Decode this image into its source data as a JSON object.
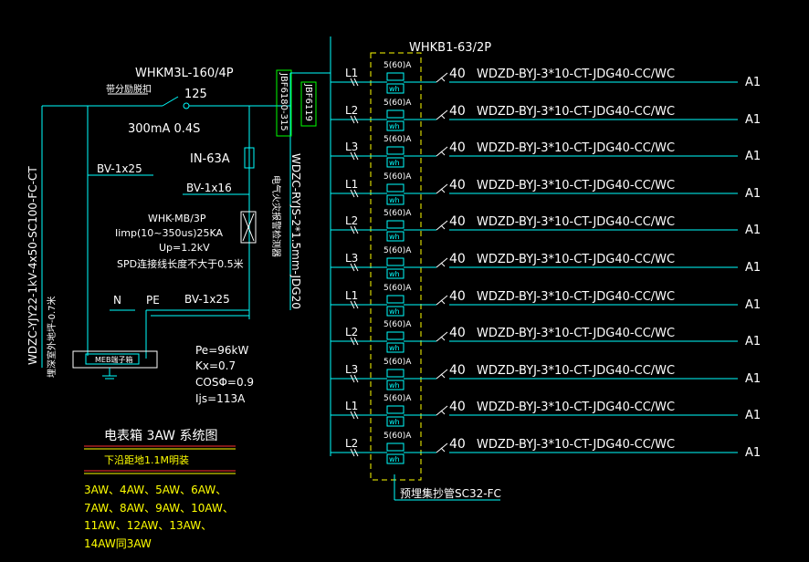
{
  "colors": {
    "background": "#000000",
    "wire": "#00ffff",
    "text": "#ffffff",
    "meter": "#00ffff",
    "dash_box": "#ffff00",
    "green_box": "#00ff00",
    "underline_red": "#ff3030"
  },
  "incoming": {
    "cable": "WDZC-YJY22-1kV-4x50-SC100-FC-CT",
    "note": "埋深室外地坪-0.7米"
  },
  "main_breaker": {
    "model": "WHKM3L-160/4P",
    "note": "带分励脱扣",
    "rating": "125",
    "leakage": "300mA 0.4S"
  },
  "fuse": {
    "label": "IN-63A"
  },
  "spd": {
    "model": "WHK-MB/3P",
    "imp": "Iimp(10~350us)25KA",
    "up": "Up=1.2kV",
    "note": "SPD连接线长度不大于0.5米"
  },
  "ground_wires": {
    "bv1": "BV-1x25",
    "bv2": "BV-1x16",
    "bv3": "BV-1x25",
    "n": "N",
    "pe": "PE",
    "meb": "MEB端子箱"
  },
  "fire_monitor": {
    "jbf1": "JBF6180-315",
    "jbf2": "JBF6119",
    "note": "电气火灾报警检测器",
    "cable": "WDZC-RYJS-2*1.5mm-JDG20"
  },
  "params": {
    "pe": "Pe=96kW",
    "kx": "Kx=0.7",
    "cos": "COSΦ=0.9",
    "ijs": "Ijs=113A"
  },
  "title_block": {
    "title": "电表箱 3AW 系统图",
    "mount": "下沿距地1.1M明装",
    "applies": [
      "3AW、4AW、5AW、6AW、",
      "7AW、8AW、9AW、10AW、",
      "11AW、12AW、13AW、",
      "14AW同3AW"
    ]
  },
  "branch_breaker": "WHKB1-63/2P",
  "spare_pipe": "预埋集抄管SC32-FC",
  "branches": [
    {
      "phase": "L1",
      "meter": "5(60)A",
      "wh": "wh",
      "rating": "40",
      "cable": "WDZD-BYJ-3*10-CT-JDG40-CC/WC",
      "dest": "A1"
    },
    {
      "phase": "L2",
      "meter": "5(60)A",
      "wh": "wh",
      "rating": "40",
      "cable": "WDZD-BYJ-3*10-CT-JDG40-CC/WC",
      "dest": "A1"
    },
    {
      "phase": "L3",
      "meter": "5(60)A",
      "wh": "wh",
      "rating": "40",
      "cable": "WDZD-BYJ-3*10-CT-JDG40-CC/WC",
      "dest": "A1"
    },
    {
      "phase": "L1",
      "meter": "5(60)A",
      "wh": "wh",
      "rating": "40",
      "cable": "WDZD-BYJ-3*10-CT-JDG40-CC/WC",
      "dest": "A1"
    },
    {
      "phase": "L2",
      "meter": "5(60)A",
      "wh": "wh",
      "rating": "40",
      "cable": "WDZD-BYJ-3*10-CT-JDG40-CC/WC",
      "dest": "A1"
    },
    {
      "phase": "L3",
      "meter": "5(60)A",
      "wh": "wh",
      "rating": "40",
      "cable": "WDZD-BYJ-3*10-CT-JDG40-CC/WC",
      "dest": "A1"
    },
    {
      "phase": "L1",
      "meter": "5(60)A",
      "wh": "wh",
      "rating": "40",
      "cable": "WDZD-BYJ-3*10-CT-JDG40-CC/WC",
      "dest": "A1"
    },
    {
      "phase": "L2",
      "meter": "5(60)A",
      "wh": "wh",
      "rating": "40",
      "cable": "WDZD-BYJ-3*10-CT-JDG40-CC/WC",
      "dest": "A1"
    },
    {
      "phase": "L3",
      "meter": "5(60)A",
      "wh": "wh",
      "rating": "40",
      "cable": "WDZD-BYJ-3*10-CT-JDG40-CC/WC",
      "dest": "A1"
    },
    {
      "phase": "L1",
      "meter": "5(60)A",
      "wh": "wh",
      "rating": "40",
      "cable": "WDZD-BYJ-3*10-CT-JDG40-CC/WC",
      "dest": "A1"
    },
    {
      "phase": "L2",
      "meter": "5(60)A",
      "wh": "wh",
      "rating": "40",
      "cable": "WDZD-BYJ-3*10-CT-JDG40-CC/WC",
      "dest": "A1"
    }
  ]
}
